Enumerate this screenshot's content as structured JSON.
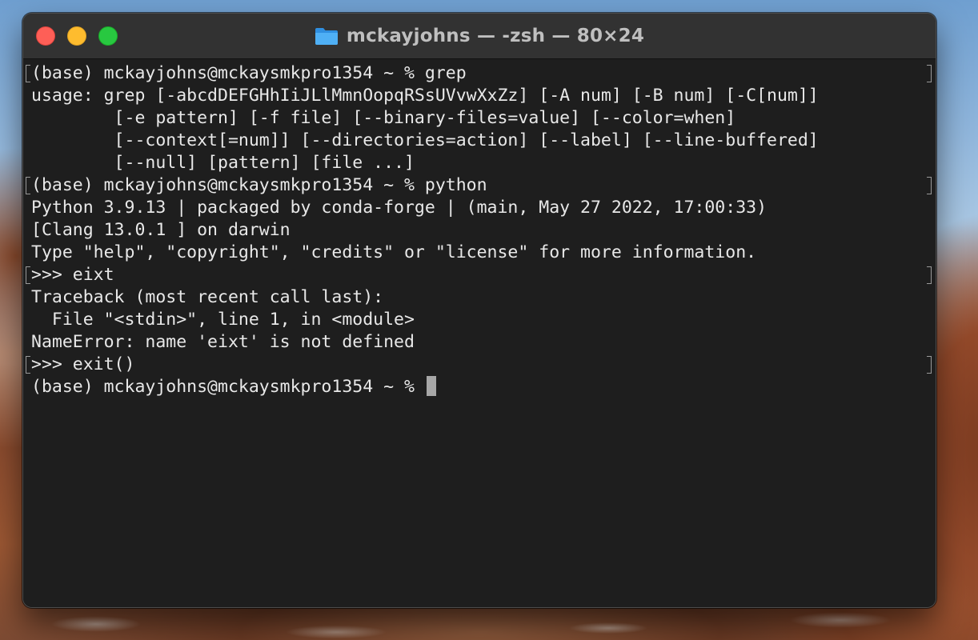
{
  "window": {
    "title": "mckayjohns — -zsh — 80×24",
    "folder_icon": "folder-icon"
  },
  "colors": {
    "terminal_bg": "#1e1e1e",
    "titlebar_bg": "#323232",
    "text": "#e8e8e8",
    "close": "#fe5f57",
    "minimize": "#febc2e",
    "zoom": "#28c840"
  },
  "terminal": {
    "lines": [
      {
        "text": "(base) mckayjohns@mckaysmkpro1354 ~ % grep",
        "marked": true
      },
      {
        "text": "usage: grep [-abcdDEFGHhIiJLlMmnOopqRSsUVvwXxZz] [-A num] [-B num] [-C[num]]",
        "marked": false
      },
      {
        "text": "        [-e pattern] [-f file] [--binary-files=value] [--color=when]",
        "marked": false
      },
      {
        "text": "        [--context[=num]] [--directories=action] [--label] [--line-buffered]",
        "marked": false
      },
      {
        "text": "        [--null] [pattern] [file ...]",
        "marked": false
      },
      {
        "text": "(base) mckayjohns@mckaysmkpro1354 ~ % python",
        "marked": true
      },
      {
        "text": "Python 3.9.13 | packaged by conda-forge | (main, May 27 2022, 17:00:33)",
        "marked": false
      },
      {
        "text": "[Clang 13.0.1 ] on darwin",
        "marked": false
      },
      {
        "text": "Type \"help\", \"copyright\", \"credits\" or \"license\" for more information.",
        "marked": false
      },
      {
        "text": ">>> eixt",
        "marked": true
      },
      {
        "text": "Traceback (most recent call last):",
        "marked": false
      },
      {
        "text": "  File \"<stdin>\", line 1, in <module>",
        "marked": false
      },
      {
        "text": "NameError: name 'eixt' is not defined",
        "marked": false
      },
      {
        "text": ">>> exit()",
        "marked": true
      }
    ],
    "prompt": "(base) mckayjohns@mckaysmkpro1354 ~ % "
  }
}
